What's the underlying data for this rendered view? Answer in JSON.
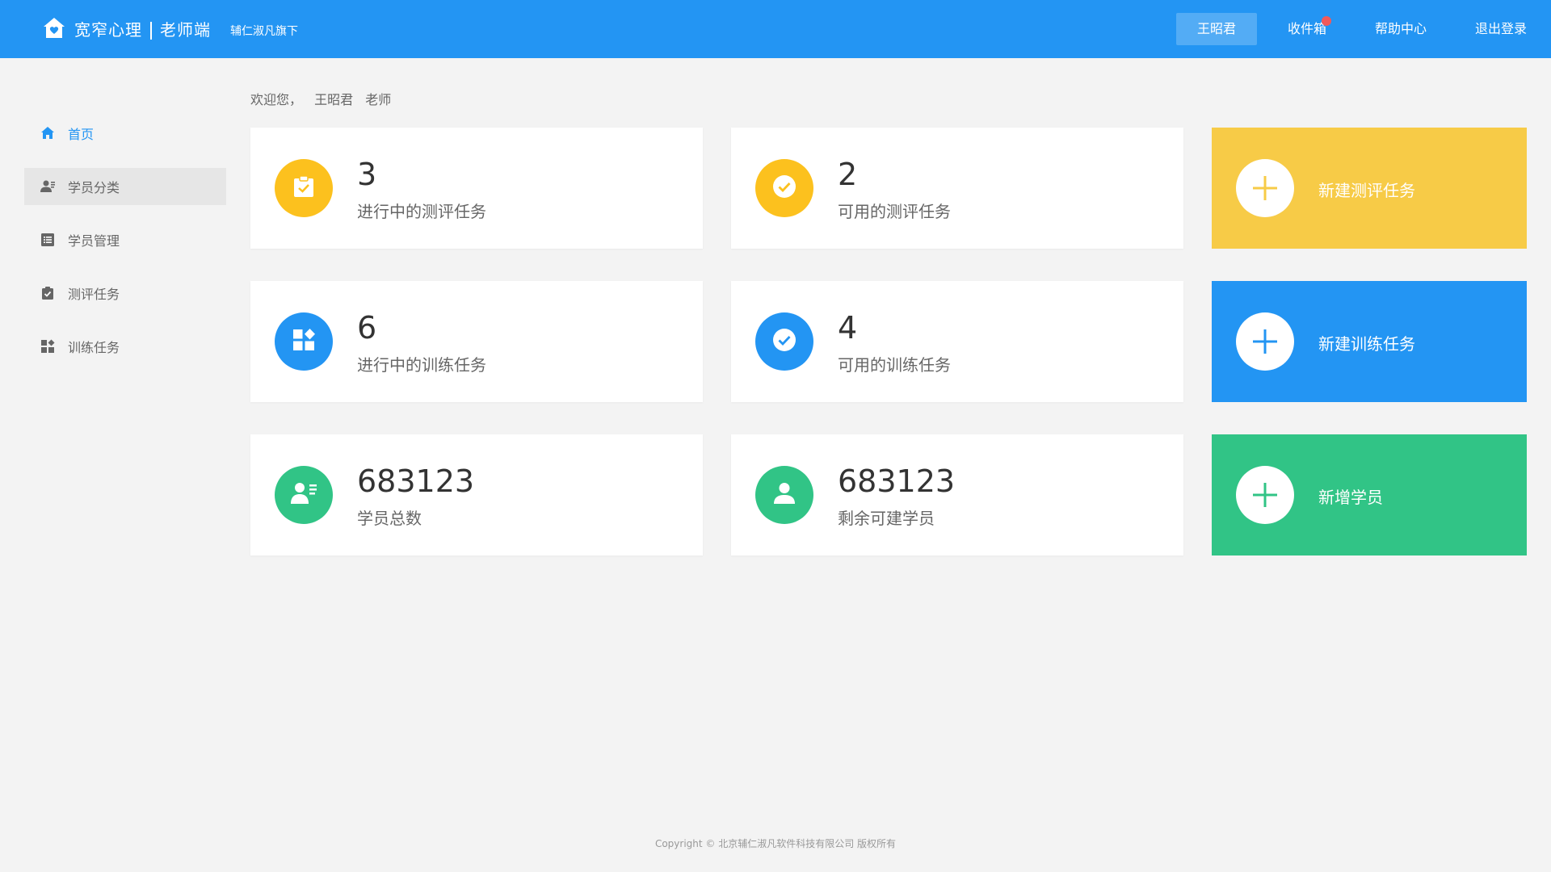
{
  "header": {
    "brand": "宽窄心理",
    "portal": "老师端",
    "subtitle": "辅仁淑凡旗下",
    "nav": {
      "user": "王昭君",
      "inbox": "收件箱",
      "help": "帮助中心",
      "logout": "退出登录"
    },
    "colors": {
      "background": "#2395f3",
      "badge": "#f2595a"
    }
  },
  "sidebar": {
    "items": [
      {
        "label": "首页",
        "icon": "home-icon",
        "active": true
      },
      {
        "label": "学员分类",
        "icon": "contact-card-icon",
        "active": false
      },
      {
        "label": "学员管理",
        "icon": "list-icon",
        "active": false
      },
      {
        "label": "测评任务",
        "icon": "clipboard-check-icon",
        "active": false
      },
      {
        "label": "训练任务",
        "icon": "apps-icon",
        "active": false
      }
    ]
  },
  "welcome": {
    "prefix": "欢迎您，",
    "name": "王昭君",
    "role": "老师"
  },
  "stats": [
    {
      "value": "3",
      "label": "进行中的测评任务",
      "icon": "clipboard-check-icon",
      "color": "#fcc11e"
    },
    {
      "value": "2",
      "label": "可用的测评任务",
      "icon": "check-circle-icon",
      "color": "#fcc11e"
    },
    {
      "value": "6",
      "label": "进行中的训练任务",
      "icon": "apps-icon",
      "color": "#2395f3"
    },
    {
      "value": "4",
      "label": "可用的训练任务",
      "icon": "check-circle-icon",
      "color": "#2395f3"
    },
    {
      "value": "683123",
      "label": "学员总数",
      "icon": "contact-card-icon",
      "color": "#31c486"
    },
    {
      "value": "683123",
      "label": "剩余可建学员",
      "icon": "person-icon",
      "color": "#31c486"
    }
  ],
  "actions": [
    {
      "label": "新建测评任务",
      "icon": "plus-icon",
      "color": "#f7cb47"
    },
    {
      "label": "新建训练任务",
      "icon": "plus-icon",
      "color": "#2395f3"
    },
    {
      "label": "新增学员",
      "icon": "plus-icon",
      "color": "#31c486"
    }
  ],
  "footer": {
    "copyright": "Copyright © 北京辅仁淑凡软件科技有限公司 版权所有"
  }
}
